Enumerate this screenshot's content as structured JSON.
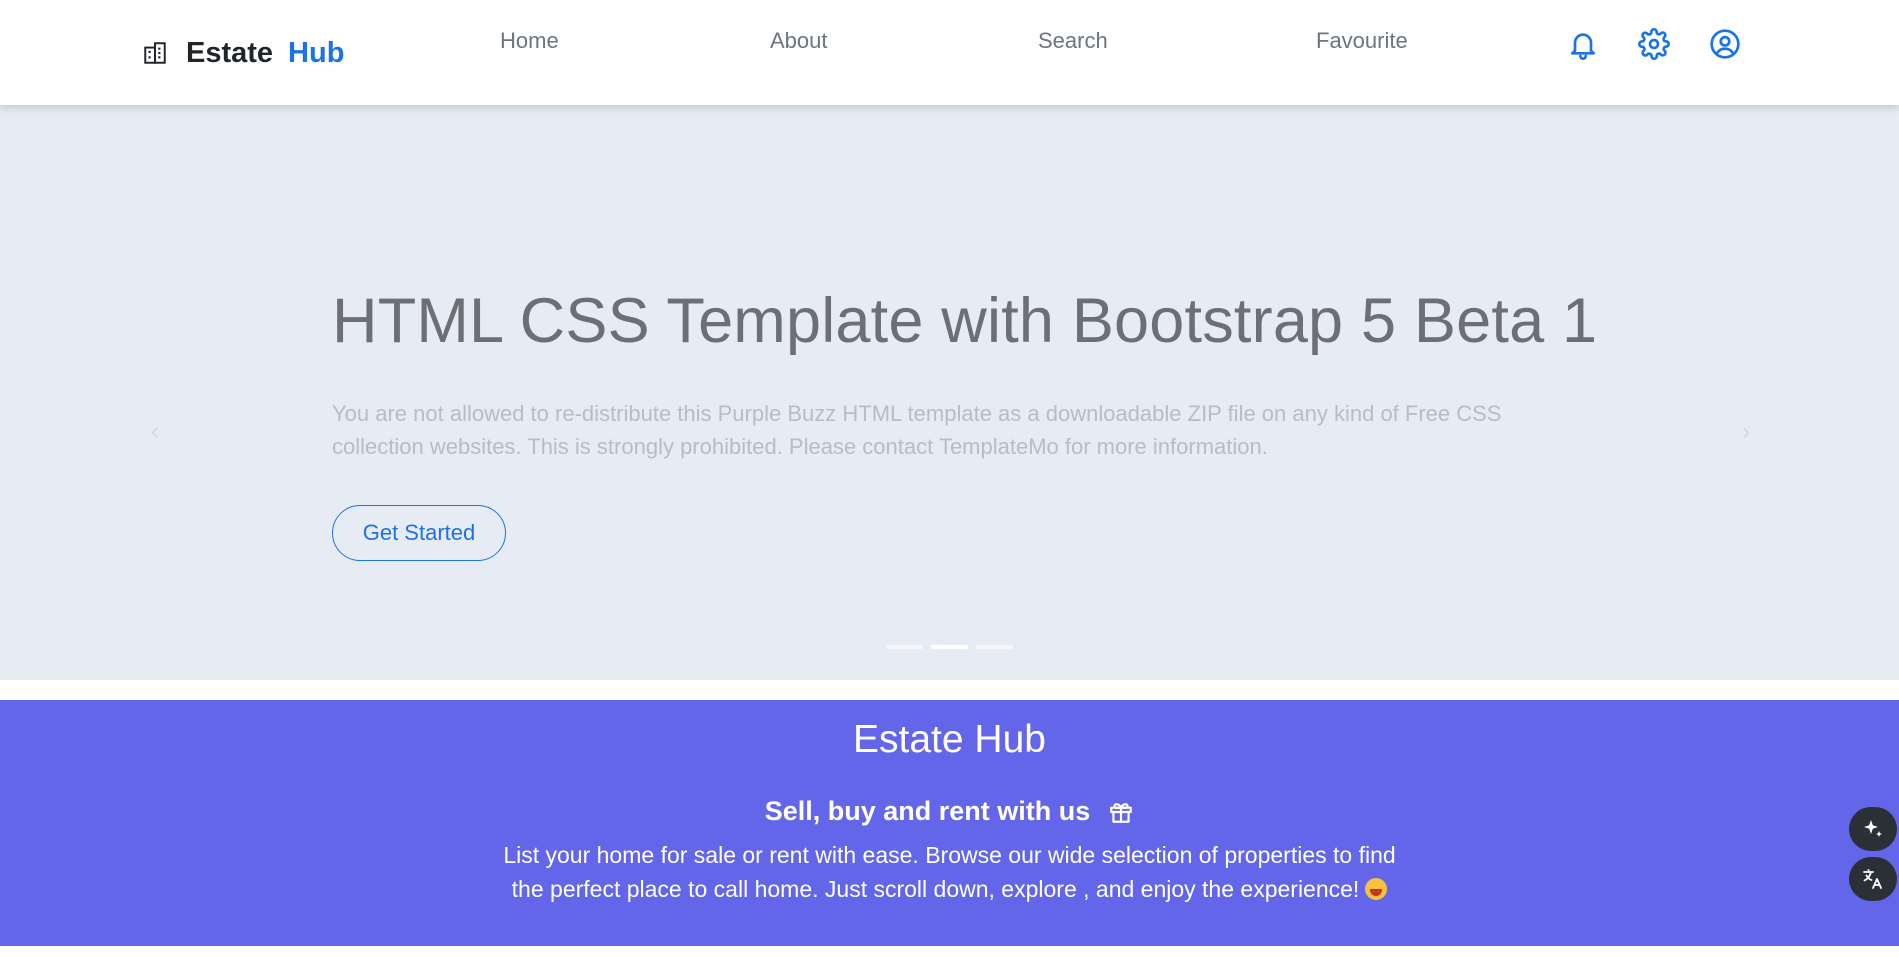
{
  "header": {
    "brand_word1": "Estate",
    "brand_word2": "Hub",
    "nav": [
      {
        "label": "Home"
      },
      {
        "label": "About"
      },
      {
        "label": "Search"
      },
      {
        "label": "Favourite"
      }
    ],
    "icons": [
      "bell-icon",
      "gear-icon",
      "user-circle-icon"
    ]
  },
  "hero": {
    "title": "HTML CSS Template with Bootstrap 5 Beta 1",
    "text": "You are not allowed to re-distribute this Purple Buzz HTML template as a downloadable ZIP file on any kind of Free CSS collection websites. This is strongly prohibited. Please contact TemplateMo for more information.",
    "button_label": "Get Started",
    "slide_count": 3,
    "active_slide": 2
  },
  "banner": {
    "title": "Estate Hub",
    "subtitle": "Sell, buy and rent with us",
    "text": "List your home for sale or rent with ease. Browse our wide selection of properties to find the perfect place to call home. Just scroll down, explore , and enjoy the experience!"
  },
  "floating_tools": [
    "sparkle-icon",
    "translate-icon"
  ],
  "colors": {
    "accent": "#1a73e8",
    "hero_bg": "#e7ebf3",
    "banner_bg": "#6366e8",
    "float_bg": "#2b2f36"
  }
}
